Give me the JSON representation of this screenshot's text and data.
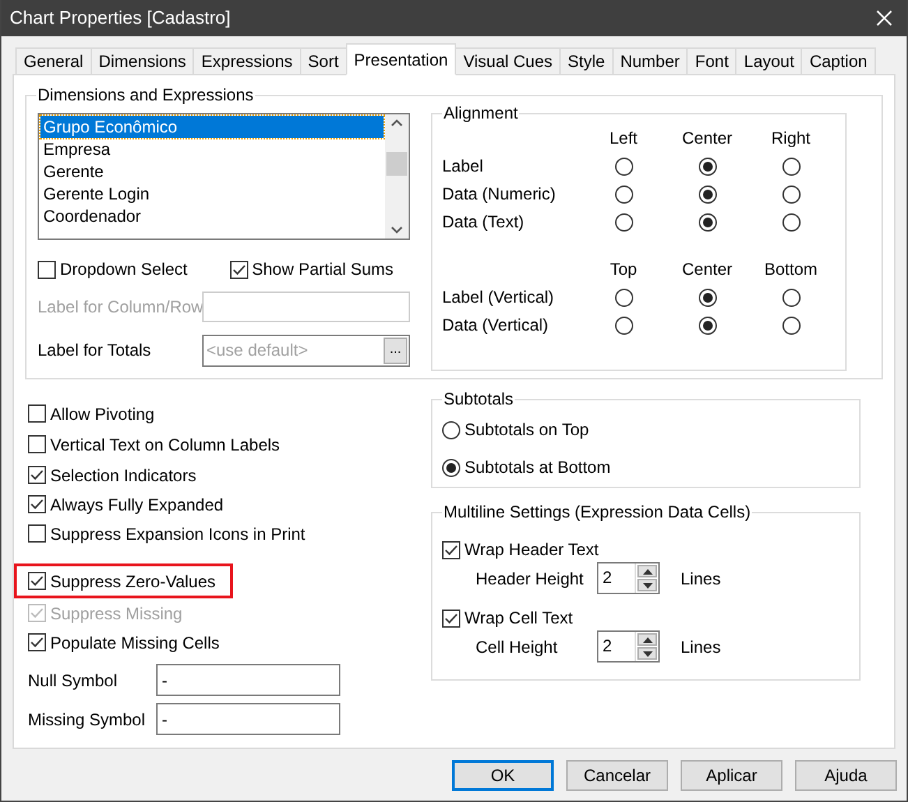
{
  "window": {
    "title": "Chart Properties [Cadastro]"
  },
  "tabs": [
    {
      "label": "General",
      "selected": false
    },
    {
      "label": "Dimensions",
      "selected": false
    },
    {
      "label": "Expressions",
      "selected": false
    },
    {
      "label": "Sort",
      "selected": false
    },
    {
      "label": "Presentation",
      "selected": true
    },
    {
      "label": "Visual Cues",
      "selected": false
    },
    {
      "label": "Style",
      "selected": false
    },
    {
      "label": "Number",
      "selected": false
    },
    {
      "label": "Font",
      "selected": false
    },
    {
      "label": "Layout",
      "selected": false
    },
    {
      "label": "Caption",
      "selected": false
    }
  ],
  "dimensions_group": {
    "title": "Dimensions and Expressions",
    "list": [
      {
        "label": "Grupo Econômico",
        "selected": true
      },
      {
        "label": "Empresa",
        "selected": false
      },
      {
        "label": "Gerente",
        "selected": false
      },
      {
        "label": "Gerente Login",
        "selected": false
      },
      {
        "label": "Coordenador",
        "selected": false
      }
    ],
    "checks": [
      {
        "label": "Dropdown Select",
        "checked": false
      },
      {
        "label": "Show Partial Sums",
        "checked": true
      }
    ],
    "label_column_row": {
      "label": "Label for Column/Row",
      "disabled": true
    },
    "label_totals": {
      "label": "Label for Totals",
      "placeholder": "<use default>",
      "button": "..."
    }
  },
  "alignment": {
    "title": "Alignment",
    "sections": [
      {
        "columns": [
          "Left",
          "Center",
          "Right"
        ],
        "rows": [
          {
            "label": "Label",
            "options": [
              {
                "selected": false
              },
              {
                "selected": true
              },
              {
                "selected": false
              }
            ]
          },
          {
            "label": "Data (Numeric)",
            "options": [
              {
                "selected": false
              },
              {
                "selected": true
              },
              {
                "selected": false
              }
            ]
          },
          {
            "label": "Data (Text)",
            "options": [
              {
                "selected": false
              },
              {
                "selected": true
              },
              {
                "selected": false
              }
            ]
          }
        ]
      },
      {
        "columns": [
          "Top",
          "Center",
          "Bottom"
        ],
        "rows": [
          {
            "label": "Label (Vertical)",
            "options": [
              {
                "selected": false
              },
              {
                "selected": true
              },
              {
                "selected": false
              }
            ]
          },
          {
            "label": "Data (Vertical)",
            "options": [
              {
                "selected": false
              },
              {
                "selected": true
              },
              {
                "selected": false
              }
            ]
          }
        ]
      }
    ]
  },
  "options": [
    {
      "label": "Allow Pivoting",
      "checked": false,
      "disabled": false,
      "highlighted": false
    },
    {
      "label": "Vertical Text on Column Labels",
      "checked": false,
      "disabled": false,
      "highlighted": false
    },
    {
      "label": "Selection Indicators",
      "checked": true,
      "disabled": false,
      "highlighted": false
    },
    {
      "label": "Always Fully Expanded",
      "checked": true,
      "disabled": false,
      "highlighted": false
    },
    {
      "label": "Suppress Expansion Icons in Print",
      "checked": false,
      "disabled": false,
      "highlighted": false
    },
    {
      "label": "Suppress Zero-Values",
      "checked": true,
      "disabled": false,
      "highlighted": true
    },
    {
      "label": "Suppress Missing",
      "checked": true,
      "disabled": true,
      "highlighted": false
    },
    {
      "label": "Populate Missing Cells",
      "checked": true,
      "disabled": false,
      "highlighted": false
    }
  ],
  "symbols": [
    {
      "label": "Null Symbol",
      "value": "-"
    },
    {
      "label": "Missing Symbol",
      "value": "-"
    }
  ],
  "subtotals": {
    "title": "Subtotals",
    "options": [
      {
        "label": "Subtotals on Top",
        "selected": false
      },
      {
        "label": "Subtotals at Bottom",
        "selected": true
      }
    ]
  },
  "multiline": {
    "title": "Multiline Settings (Expression Data Cells)",
    "items": [
      {
        "label": "Wrap Header Text",
        "checked": true,
        "height_label": "Header Height",
        "value": "2",
        "unit": "Lines"
      },
      {
        "label": "Wrap Cell Text",
        "checked": true,
        "height_label": "Cell Height",
        "value": "2",
        "unit": "Lines"
      }
    ]
  },
  "buttons": [
    {
      "label": "OK",
      "default": true
    },
    {
      "label": "Cancelar",
      "default": false
    },
    {
      "label": "Aplicar",
      "default": false
    },
    {
      "label": "Ajuda",
      "default": false
    }
  ]
}
